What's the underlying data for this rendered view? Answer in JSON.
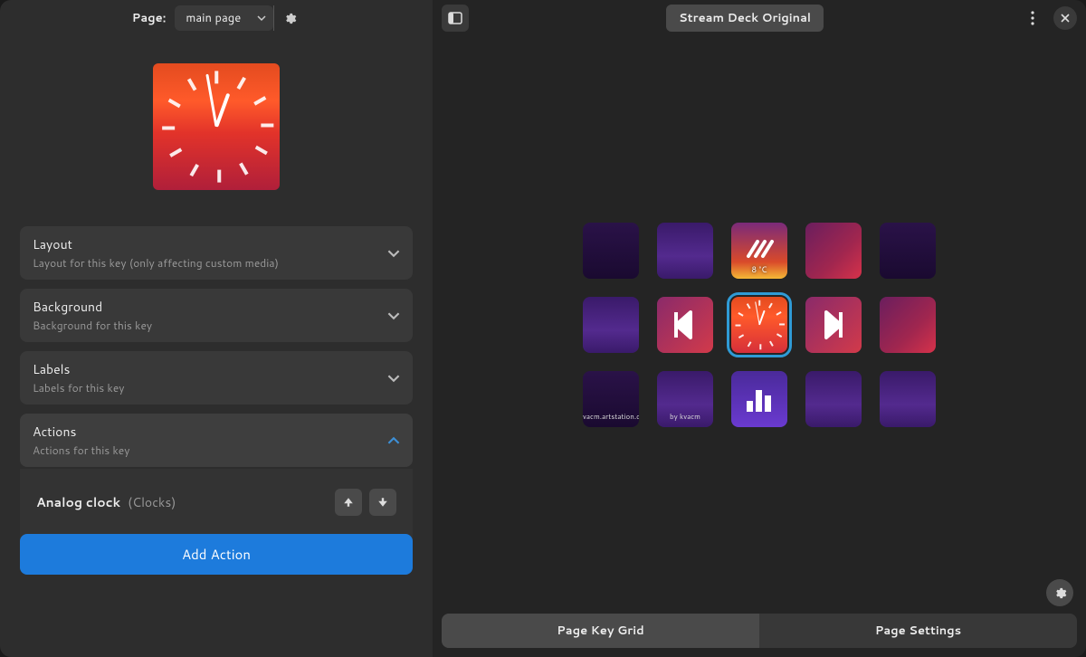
{
  "left": {
    "page_label": "Page:",
    "page_select_value": "main page",
    "sections": {
      "layout": {
        "title": "Layout",
        "sub": "Layout for this key (only affecting custom media)"
      },
      "background": {
        "title": "Background",
        "sub": "Background for this key"
      },
      "labels": {
        "title": "Labels",
        "sub": "Labels for this key"
      },
      "actions": {
        "title": "Actions",
        "sub": "Actions for this key"
      }
    },
    "action_item": {
      "name": "Analog clock",
      "group": "(Clocks)"
    },
    "add_action_label": "Add Action"
  },
  "right": {
    "device_name": "Stream Deck Original",
    "grid": {
      "rows": 3,
      "cols": 5,
      "keys": [
        {
          "idx": 0,
          "style": "dark"
        },
        {
          "idx": 1,
          "style": "glow-purple"
        },
        {
          "idx": 2,
          "style": "weather",
          "label": "8 °C"
        },
        {
          "idx": 3,
          "style": "glow-red"
        },
        {
          "idx": 4,
          "style": "dark"
        },
        {
          "idx": 5,
          "style": "glow-purple"
        },
        {
          "idx": 6,
          "style": "prev"
        },
        {
          "idx": 7,
          "style": "clock",
          "selected": true
        },
        {
          "idx": 8,
          "style": "next"
        },
        {
          "idx": 9,
          "style": "glow-red"
        },
        {
          "idx": 10,
          "style": "dark",
          "text": "vacm.artstation.c"
        },
        {
          "idx": 11,
          "style": "glow-purple",
          "text": "by kvacm"
        },
        {
          "idx": 12,
          "style": "bars"
        },
        {
          "idx": 13,
          "style": "glow-purple"
        },
        {
          "idx": 14,
          "style": "glow-purple"
        }
      ]
    },
    "footer": {
      "tab1": "Page Key Grid",
      "tab2": "Page Settings",
      "active": "tab1"
    }
  }
}
